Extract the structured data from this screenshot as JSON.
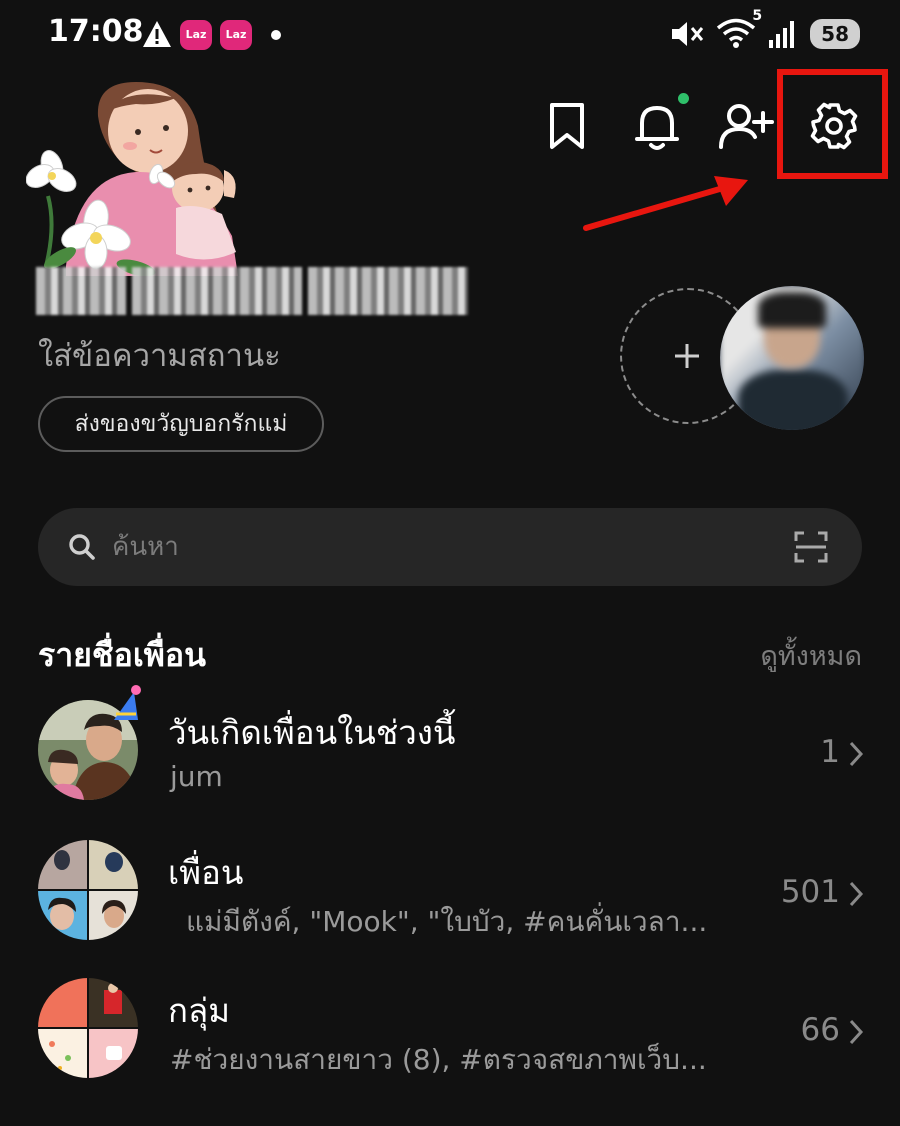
{
  "status_bar": {
    "time": "17:08",
    "notification_apps": [
      "Laz",
      "Laz"
    ],
    "signal_tag": "5",
    "battery": "58"
  },
  "header": {
    "icons": [
      "bookmark-icon",
      "bell-icon",
      "add-friend-icon",
      "settings-icon"
    ],
    "notification_dot_color": "#2fc06a",
    "annotation_color": "#e8160f"
  },
  "profile": {
    "status_message": "ใส่ข้อความสถานะ",
    "gift_button": "ส่งของขวัญบอกรักแม่"
  },
  "search": {
    "placeholder": "ค้นหา"
  },
  "friends_section": {
    "title": "รายชื่อเพื่อน",
    "see_all": "ดูทั้งหมด",
    "rows": [
      {
        "title": "วันเกิดเพื่อนในช่วงนี้",
        "subtitle": "jum",
        "count": "1"
      },
      {
        "title": "เพื่อน",
        "subtitle": "แม่มีตังค์, \"Mook\", \"ใบบัว, #คนคั่นเวลา...",
        "count": "501"
      },
      {
        "title": "กลุ่ม",
        "subtitle": "#ช่วยงานสายขาว (8), #ตรวจสขภาพเว็บ...",
        "count": "66"
      }
    ]
  }
}
